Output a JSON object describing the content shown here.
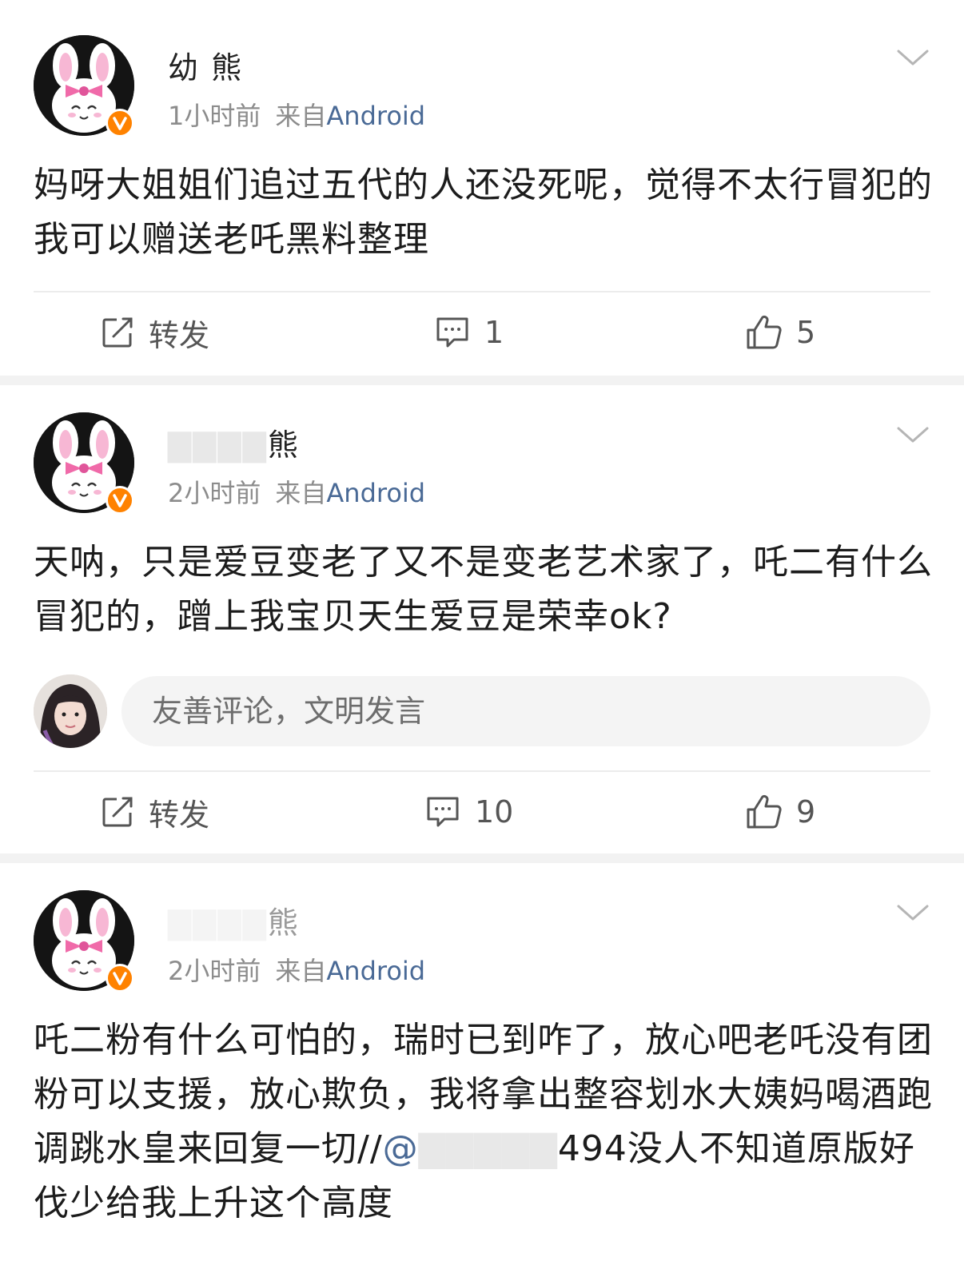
{
  "posts": [
    {
      "username": "幼   熊",
      "time": "1小时前",
      "source_prefix": "来自",
      "device": "Android",
      "text": "妈呀大姐姐们追过五代的人还没死呢，觉得不太行冒犯的我可以赠送老吒黑料整理",
      "repost_label": "转发",
      "comment_count": "1",
      "like_count": "5"
    },
    {
      "username": "熊",
      "time": "2小时前",
      "source_prefix": "来自",
      "device": "Android",
      "text": "天呐，只是爱豆变老了又不是变老艺术家了，吒二有什么冒犯的，蹭上我宝贝天生爱豆是荣幸ok?",
      "comment_placeholder": "友善评论，文明发言",
      "repost_label": "转发",
      "comment_count": "10",
      "like_count": "9"
    },
    {
      "username": "熊",
      "time": "2小时前",
      "source_prefix": "来自",
      "device": "Android",
      "text_part1": "吒二粉有什么可怕的，瑞时已到咋了，放心吧老吒没有团粉可以支援，放心欺负，我将拿出整容划水大姨妈喝酒跑调跳水皇来回复一切//",
      "mention": "@",
      "text_part2": "494没人不知道原版好伐少给我上升这个高度"
    }
  ],
  "colors": {
    "vip_badge": "#ff8200",
    "link": "#4a6a96",
    "separator": "#f2f2f2"
  },
  "icons": {
    "repost": "repost-icon",
    "comment": "comment-icon",
    "like": "thumbs-up-icon",
    "menu": "chevron-down-icon",
    "badge": "orange-v-badge-icon"
  }
}
